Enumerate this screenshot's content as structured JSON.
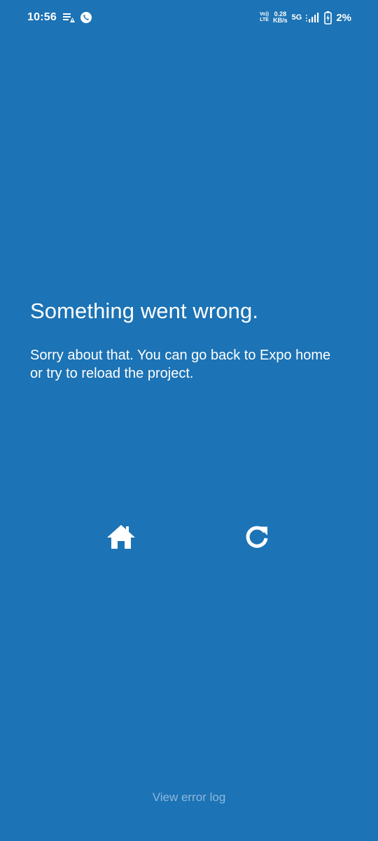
{
  "status_bar": {
    "time": "10:56",
    "volte_top": "Vo))",
    "volte_bottom": "LTE",
    "net_speed_value": "0.28",
    "net_speed_unit": "KB/s",
    "network_type": "5G",
    "battery_percent": "2%",
    "icons": [
      "data-saver-icon",
      "phone-call-icon",
      "signal-icon",
      "battery-charging-icon"
    ]
  },
  "error": {
    "title": "Something went wrong.",
    "message": "Sorry about that. You can go back to Expo home or try to reload the project."
  },
  "actions": {
    "home_icon": "home-icon",
    "reload_icon": "reload-icon"
  },
  "footer": {
    "view_error_log": "View error log"
  },
  "colors": {
    "background": "#1c73b5",
    "text": "#ffffff",
    "link_muted": "#8fb8db"
  }
}
